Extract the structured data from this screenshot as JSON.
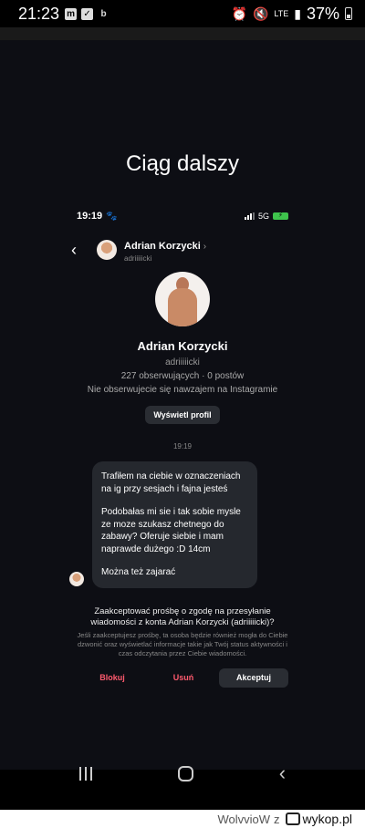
{
  "outer_status": {
    "time": "21:23",
    "notification_icons": [
      "m",
      "✓",
      "b"
    ],
    "battery": "37%",
    "network": "LTE"
  },
  "story": {
    "title": "Ciąg dalszy"
  },
  "inner_status": {
    "time": "19:19",
    "network": "5G"
  },
  "chat_header": {
    "name": "Adrian Korzycki",
    "username": "adriiiiicki"
  },
  "profile": {
    "name": "Adrian Korzycki",
    "username": "adriiiiicki",
    "stats": "227 obserwujących · 0 postów",
    "follow_note": "Nie obserwujecie się nawzajem na Instagramie",
    "view_profile_label": "Wyświetl profil"
  },
  "messages": {
    "time": "19:19",
    "paragraphs": [
      "Trafiłem na ciebie w oznaczeniach na ig przy sesjach i fajna jesteś",
      "Podobałas mi sie i tak sobie mysle ze moze szukasz chetnego do zabawy? Oferuje siebie i mam naprawde dużego :D 14cm",
      "Można też zajarać"
    ]
  },
  "request": {
    "question": "Zaakceptować prośbę o zgodę na przesyłanie wiadomości z konta Adrian Korzycki (adriiiiicki)?",
    "info": "Jeśli zaakceptujesz prośbę, ta osoba będzie również mogła do Ciebie dzwonić oraz wyświetlać informacje takie jak Twój status aktywności i czas odczytania przez Ciebie wiadomości.",
    "block_label": "Blokuj",
    "delete_label": "Usuń",
    "accept_label": "Akceptuj"
  },
  "footer": {
    "author": "WolvvioW",
    "connector": "z",
    "site": "wykop.pl"
  },
  "colors": {
    "story_bg": "#0d0e14",
    "danger": "#ff5a6e",
    "bubble": "#25282e"
  }
}
